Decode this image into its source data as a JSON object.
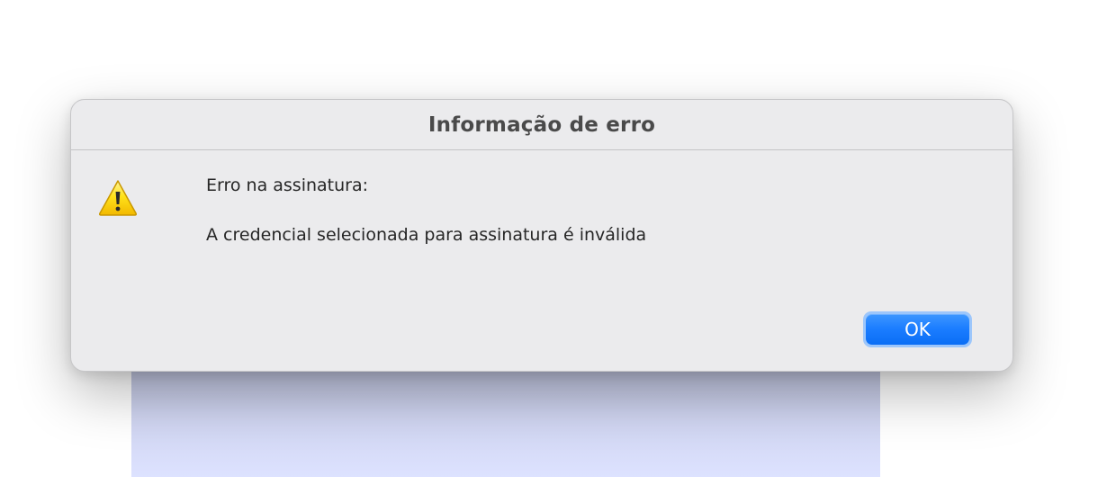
{
  "dialog": {
    "title": "Informação de erro",
    "icon": "warning-icon",
    "message_line1": "Erro na assinatura:",
    "message_line2": "A credencial selecionada para assinatura é inválida",
    "ok_label": "OK"
  },
  "colors": {
    "accent": "#1a7cff",
    "dialog_background": "#ebebed",
    "warning_yellow": "#ffd600"
  }
}
